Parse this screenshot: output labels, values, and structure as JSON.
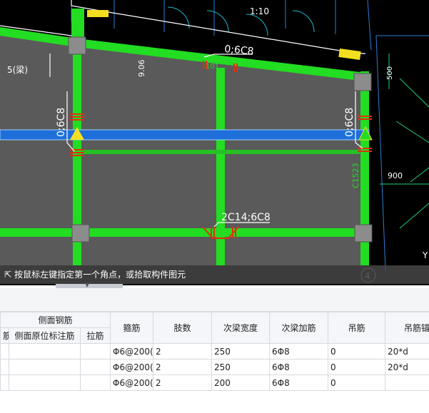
{
  "cad": {
    "labels": {
      "top_scale": "1:10",
      "beam_top": "0;6C8",
      "beam_top_sub": "101",
      "left_text": "5(梁)",
      "dim_left": "9.06",
      "col_left": "0;6C8",
      "col_right": "0;6C8",
      "right_code": "C1523",
      "bottom_beam": "2C14;6C8",
      "dim_500": "500",
      "dim_900": "900",
      "corner_label": "Y",
      "circle_num": "4"
    },
    "colors": {
      "beam": "#22dd22",
      "slab": "#5a5a5a",
      "blue": "#1e6fd9",
      "rebar": "#e03010",
      "yellow": "#f2e020"
    }
  },
  "status": {
    "icon": "cursor-arrow-icon",
    "text": "按鼠标左键指定第一个角点，或拾取构件图元"
  },
  "table": {
    "group_header": "侧面钢筋",
    "sub_headers": [
      "筋",
      "侧面原位标注筋",
      "拉筋"
    ],
    "headers": [
      "箍筋",
      "肢数",
      "次梁宽度",
      "次梁加筋",
      "吊筋",
      "吊筋锚固"
    ],
    "rows": [
      {
        "stirrup": "Φ6@200(",
        "legs": "2",
        "width": "250",
        "add": "6Φ8",
        "hanger": "0",
        "anchor": "20*d"
      },
      {
        "stirrup": "Φ6@200(",
        "legs": "2",
        "width": "250",
        "add": "6Φ8",
        "hanger": "0",
        "anchor": "20*d"
      },
      {
        "stirrup": "Φ6@200(",
        "legs": "2",
        "width": "200",
        "add": "6Φ8",
        "hanger": "0",
        "anchor": ""
      }
    ]
  }
}
